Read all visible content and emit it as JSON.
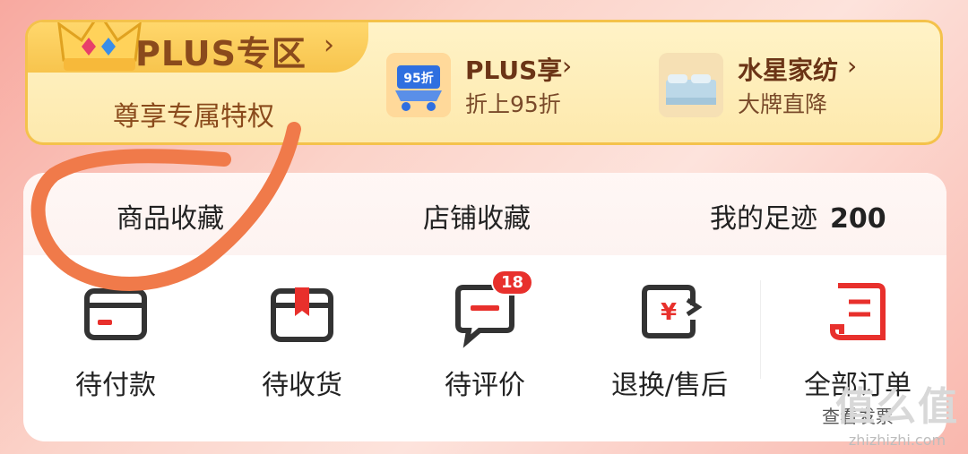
{
  "plus": {
    "title": "PLUS专区",
    "subtitle": "尊享专属特权",
    "items": [
      {
        "name": "PLUS享",
        "desc": "折上95折",
        "thumb_text": "95折",
        "icon": "shopping-cart-icon"
      },
      {
        "name": "水星家纺",
        "desc": "大牌直降",
        "icon": "bedding-icon"
      }
    ]
  },
  "favorites": {
    "items": [
      {
        "label": "商品收藏"
      },
      {
        "label": "店铺收藏"
      },
      {
        "label": "我的足迹",
        "count": "200"
      }
    ]
  },
  "orders": {
    "items": [
      {
        "label": "待付款",
        "icon": "wallet-icon"
      },
      {
        "label": "待收货",
        "icon": "package-icon"
      },
      {
        "label": "待评价",
        "icon": "comment-icon",
        "badge": "18"
      },
      {
        "label": "退换/售后",
        "icon": "refund-icon"
      },
      {
        "label": "全部订单",
        "sub": "查看发票",
        "icon": "order-list-icon"
      }
    ]
  },
  "watermark": {
    "text": "值么值",
    "url": "zhizhizhi.com"
  },
  "colors": {
    "accent": "#e8302c",
    "plus_gold": "#f4c24b",
    "scribble": "#f07a4a"
  }
}
